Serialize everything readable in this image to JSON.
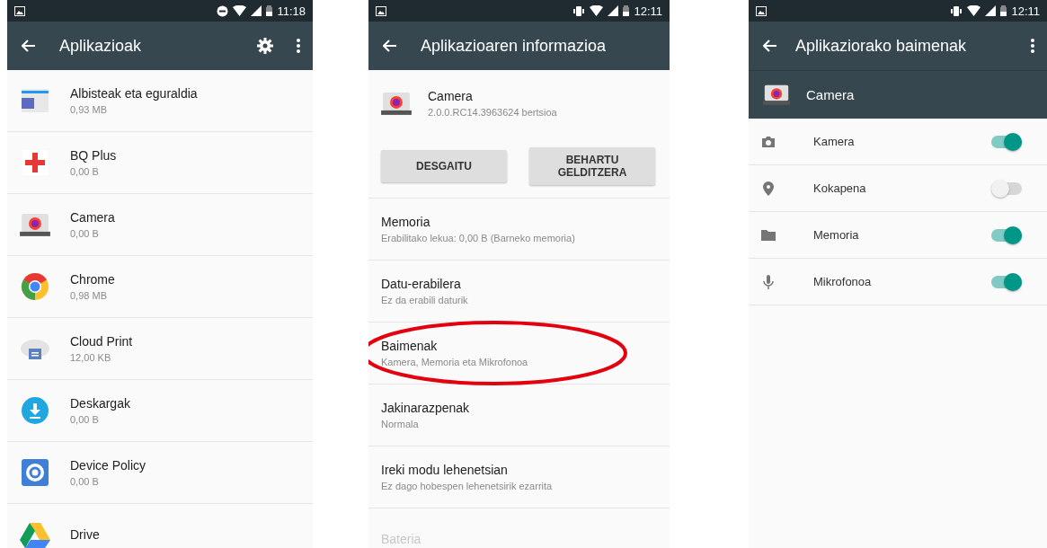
{
  "screens": [
    {
      "kind": "app_list",
      "status_bar": {
        "kind": "dnd",
        "time": "11:18"
      },
      "title": "Aplikazioak",
      "apps": [
        {
          "kind": "news",
          "name": "Albisteak eta eguraldia",
          "size": "0,93 MB"
        },
        {
          "kind": "health",
          "name": "BQ Plus",
          "size": "0,00 B"
        },
        {
          "kind": "camera",
          "name": "Camera",
          "size": "0,00 B"
        },
        {
          "kind": "browser",
          "name": "Chrome",
          "size": "0,98 MB"
        },
        {
          "kind": "cloud",
          "name": "Cloud Print",
          "size": "12,00 KB"
        },
        {
          "kind": "download",
          "name": "Deskargak",
          "size": "0,00 B"
        },
        {
          "kind": "policy",
          "name": "Device Policy",
          "size": "0,00 B"
        },
        {
          "kind": "drive",
          "name": "Drive"
        }
      ]
    },
    {
      "kind": "app_info",
      "status_bar": {
        "kind": "vibrate",
        "time": "12:11"
      },
      "title": "Aplikazioaren informazioa",
      "app": {
        "name": "Camera",
        "version": "2.0.0.RC14.3963624 bertsioa"
      },
      "buttons": [
        "DESGAITU",
        "BEHARTU GELDITZERA"
      ],
      "rows": [
        {
          "title": "Memoria",
          "subtitle": "Erabilitako lekua: 0,00 B (Barneko memoria)",
          "disabled": false,
          "circled": false
        },
        {
          "title": "Datu-erabilera",
          "subtitle": "Ez da erabili daturik",
          "disabled": false,
          "circled": false
        },
        {
          "title": "Baimenak",
          "subtitle": "Kamera, Memoria eta Mikrofonoa",
          "disabled": false,
          "circled": true
        },
        {
          "title": "Jakinarazpenak",
          "subtitle": "Normala",
          "disabled": false,
          "circled": false
        },
        {
          "title": "Ireki modu lehenetsian",
          "subtitle": "Ez dago hobespen lehenetsirik ezarrita",
          "disabled": false,
          "circled": false
        },
        {
          "title": "Bateria",
          "disabled": true,
          "circled": false
        }
      ]
    },
    {
      "kind": "permissions",
      "status_bar": {
        "kind": "vibrate",
        "time": "12:11"
      },
      "title": "Aplikaziorako baimenak",
      "app": {
        "name": "Camera"
      },
      "permissions": [
        {
          "kind": "camera",
          "label": "Kamera",
          "on": true
        },
        {
          "kind": "location",
          "label": "Kokapena",
          "on": false
        },
        {
          "kind": "storage",
          "label": "Memoria",
          "on": true
        },
        {
          "kind": "microphone",
          "label": "Mikrofonoa",
          "on": true
        }
      ]
    }
  ]
}
